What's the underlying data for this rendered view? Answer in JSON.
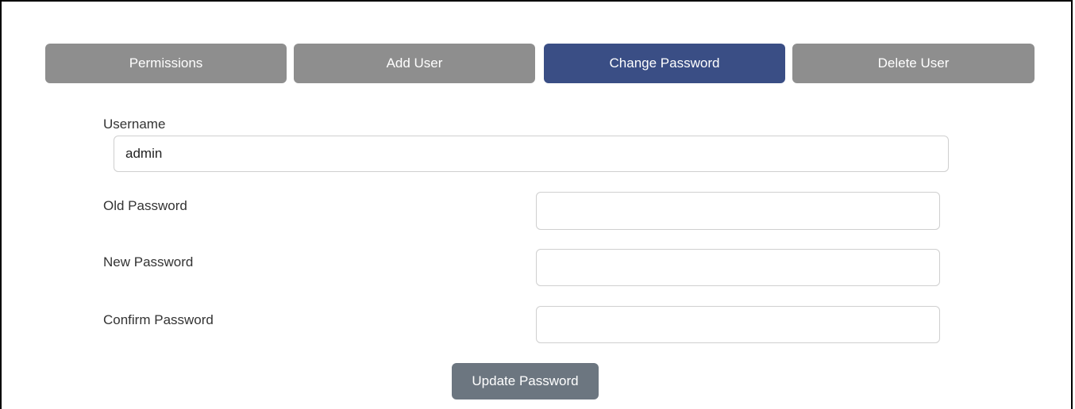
{
  "tabs": [
    {
      "label": "Permissions",
      "active": false
    },
    {
      "label": "Add User",
      "active": false
    },
    {
      "label": "Change Password",
      "active": true
    },
    {
      "label": "Delete User",
      "active": false
    }
  ],
  "form": {
    "username_label": "Username",
    "username_value": "admin",
    "old_password_label": "Old Password",
    "old_password_value": "",
    "new_password_label": "New Password",
    "new_password_value": "",
    "confirm_password_label": "Confirm Password",
    "confirm_password_value": "",
    "submit_label": "Update Password"
  },
  "colors": {
    "tab_inactive": "#8e8e8e",
    "tab_active": "#3a4e85",
    "submit_button": "#6c7680"
  }
}
